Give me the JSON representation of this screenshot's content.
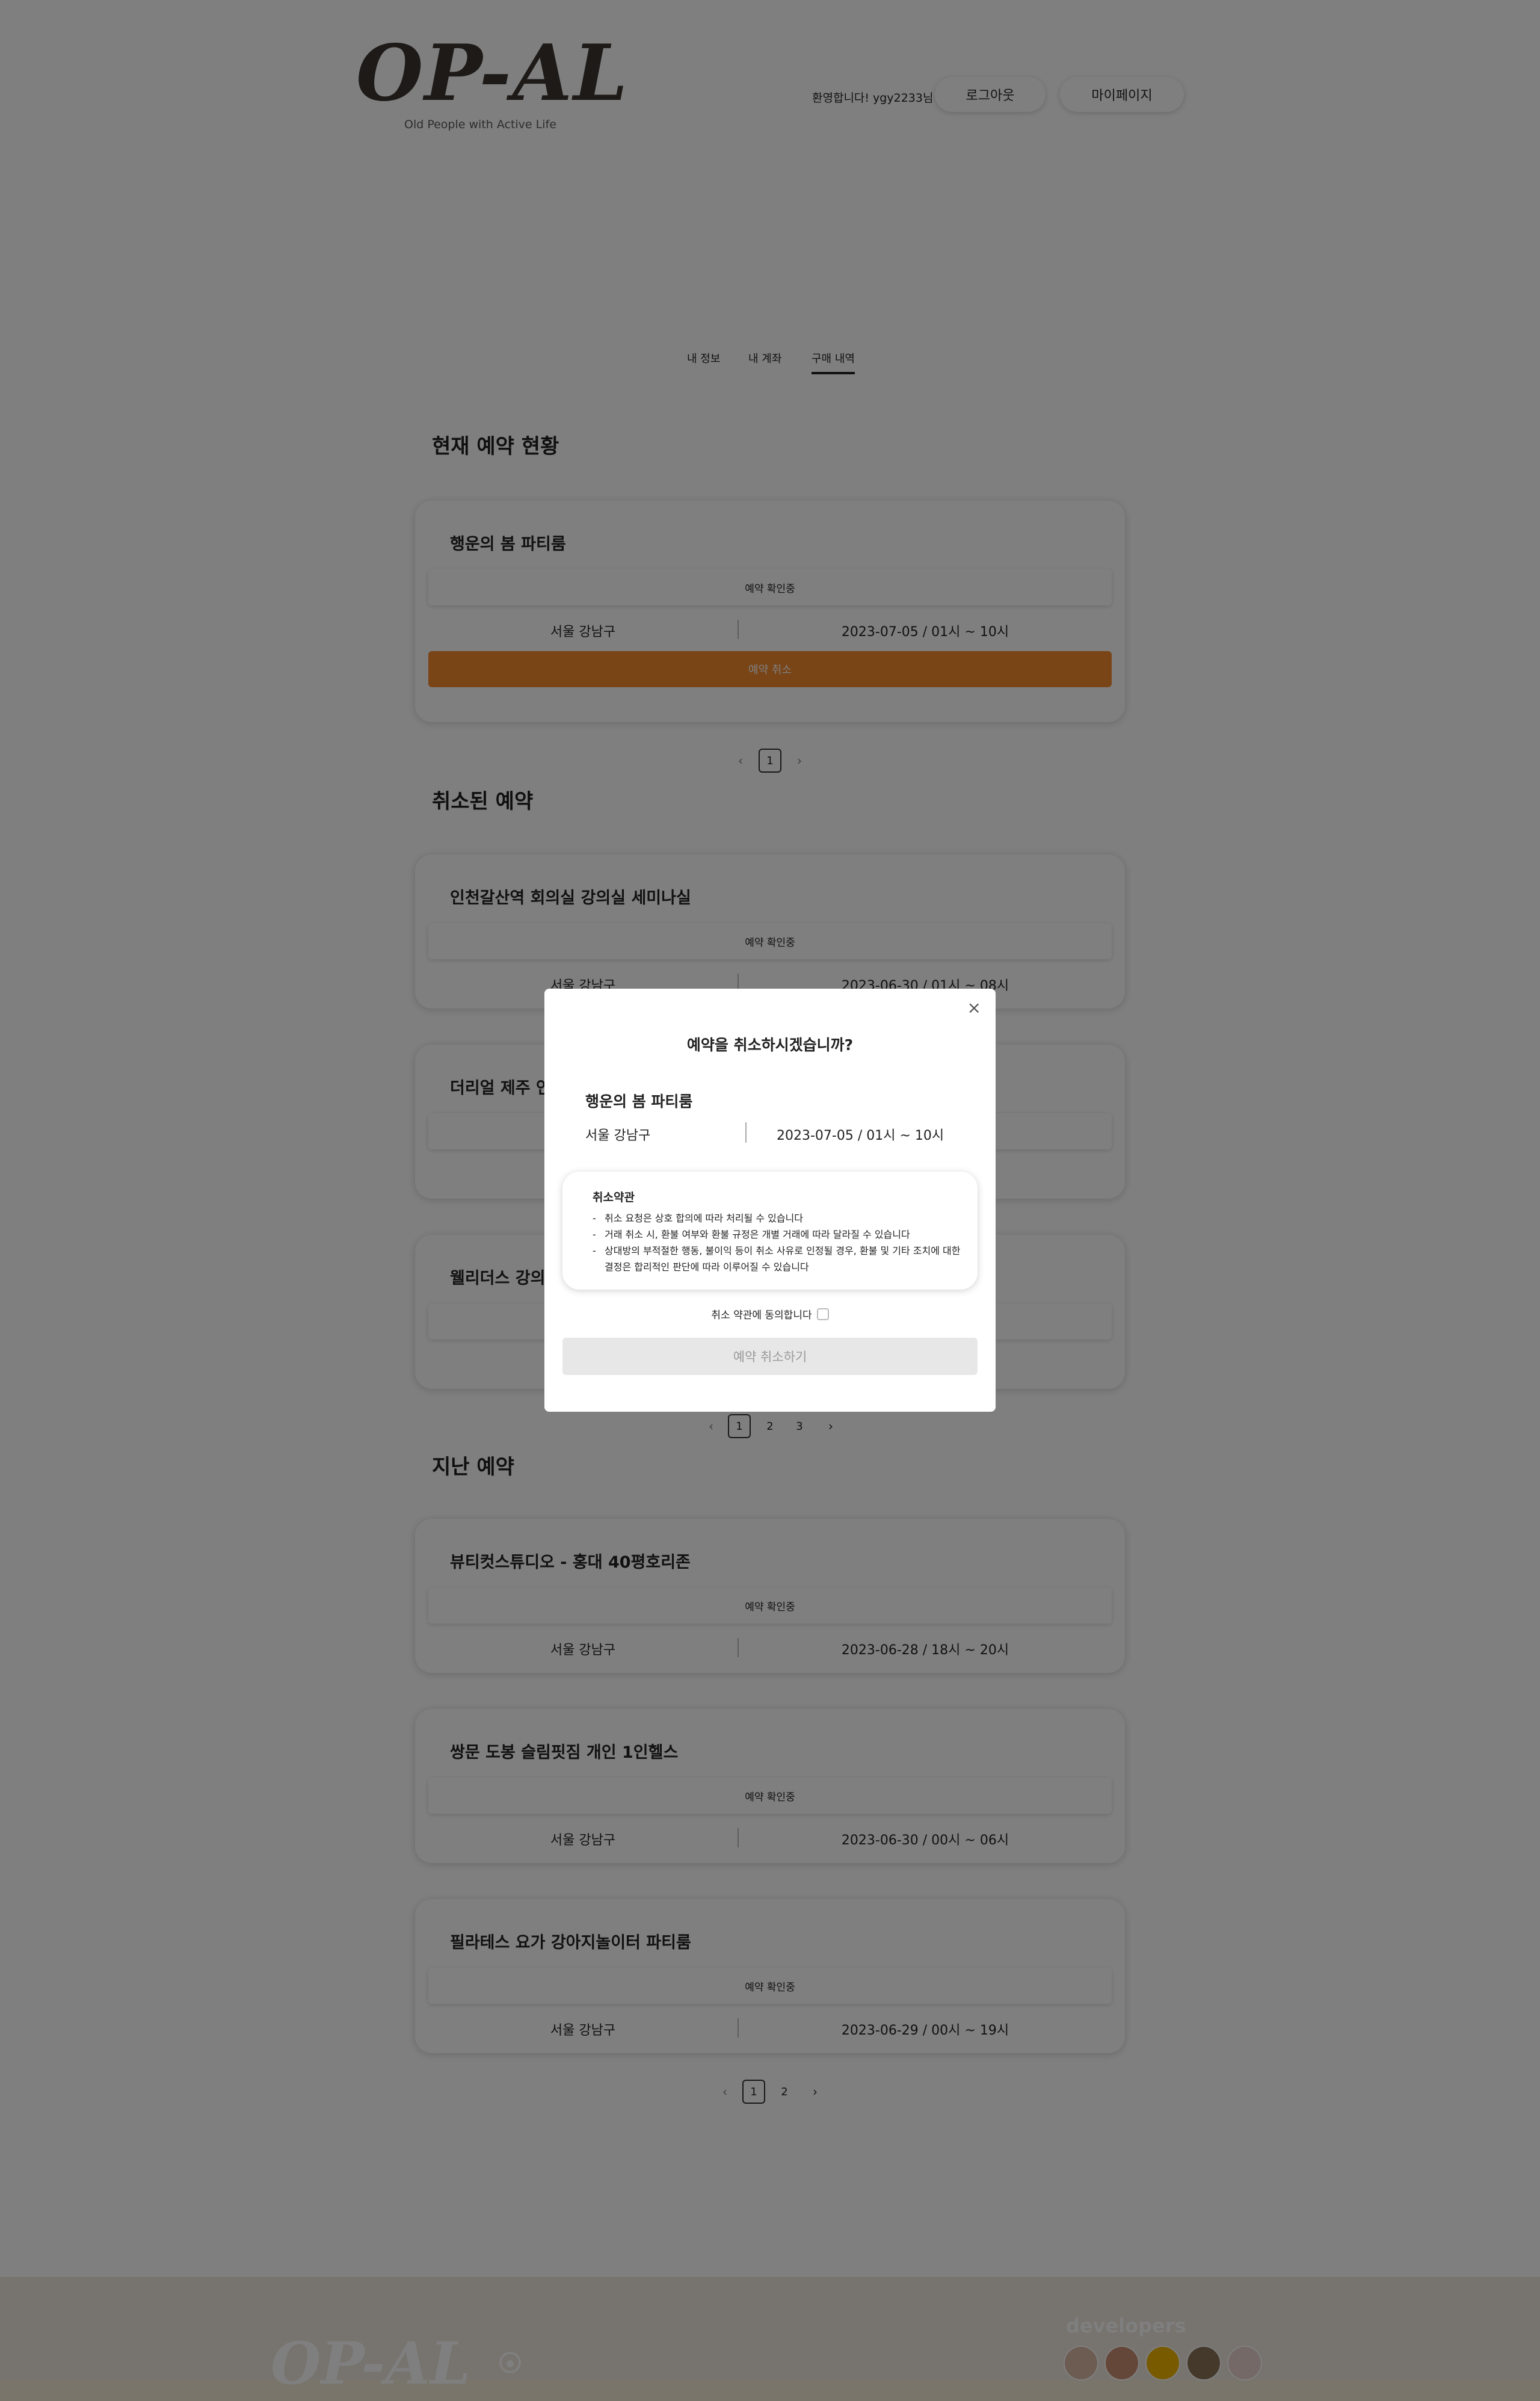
{
  "header": {
    "logo": "OP-AL",
    "tagline": "Old People with Active Life",
    "welcome": "환영합니다! ygy2233님",
    "logout": "로그아웃",
    "mypage": "마이페이지"
  },
  "tabs": [
    "내 정보",
    "내 계좌",
    "구매 내역"
  ],
  "current": {
    "title": "현재 예약 현황",
    "items": [
      {
        "name": "행운의 봄 파티룸",
        "status": "예약 확인중",
        "location": "서울 강남구",
        "date": "2023-07-05 / 01시 ~ 10시",
        "cancel": "예약 취소"
      }
    ],
    "pages": [
      "1"
    ]
  },
  "cancelled": {
    "title": "취소된 예약",
    "items": [
      {
        "name": "인천갈산역 회의실 강의실 세미나실",
        "status": "예약 확인중",
        "location": "서울 강남구",
        "date": "2023-06-30 / 01시 ~ 08시"
      },
      {
        "name": "더리얼 제주 연"
      },
      {
        "name": "웰리더스 강의"
      }
    ],
    "pages": [
      "1",
      "2",
      "3"
    ]
  },
  "past": {
    "title": "지난 예약",
    "items": [
      {
        "name": "뷰티컷스튜디오 - 홍대 40평호리존",
        "status": "예약 확인중",
        "location": "서울 강남구",
        "date": "2023-06-28 / 18시 ~ 20시"
      },
      {
        "name": "쌍문 도봉 슬림핏짐 개인 1인헬스",
        "status": "예약 확인중",
        "location": "서울 강남구",
        "date": "2023-06-30 / 00시 ~ 06시"
      },
      {
        "name": "필라테스 요가 강아지놀이터 파티룸",
        "status": "예약 확인중",
        "location": "서울 강남구",
        "date": "2023-06-29 / 00시 ~ 19시"
      }
    ],
    "pages": [
      "1",
      "2"
    ]
  },
  "modal": {
    "close": "×",
    "title": "예약을 취소하시겠습니까?",
    "room": "행운의 봄 파티룸",
    "location": "서울 강남구",
    "date": "2023-07-05 / 01시 ~ 10시",
    "terms_title": "취소약관",
    "terms": [
      "취소 요청은 상호 합의에 따라 처리될 수 있습니다",
      "거래 취소 시, 환불 여부와 환불 규정은 개별 거래에 따라 달라질 수 있습니다",
      "상대방의 부적절한 행동, 불이익 등이 취소 사유로 인정될 경우, 환불 및 기타 조치에 대한 결정은 합리적인 판단에 따라 이루어질 수 있습니다"
    ],
    "agree": "취소 약관에 동의합니다",
    "submit": "예약 취소하기"
  },
  "footer": {
    "logo": "OP-AL",
    "developers": "developers",
    "avatar_colors": [
      "#d9b9a3",
      "#c98e70",
      "#f0b400",
      "#8a7357",
      "#e9d3cf"
    ]
  },
  "colors": {
    "accent": "#f28a2e",
    "overlay": "rgba(0,0,0,0.5)"
  }
}
